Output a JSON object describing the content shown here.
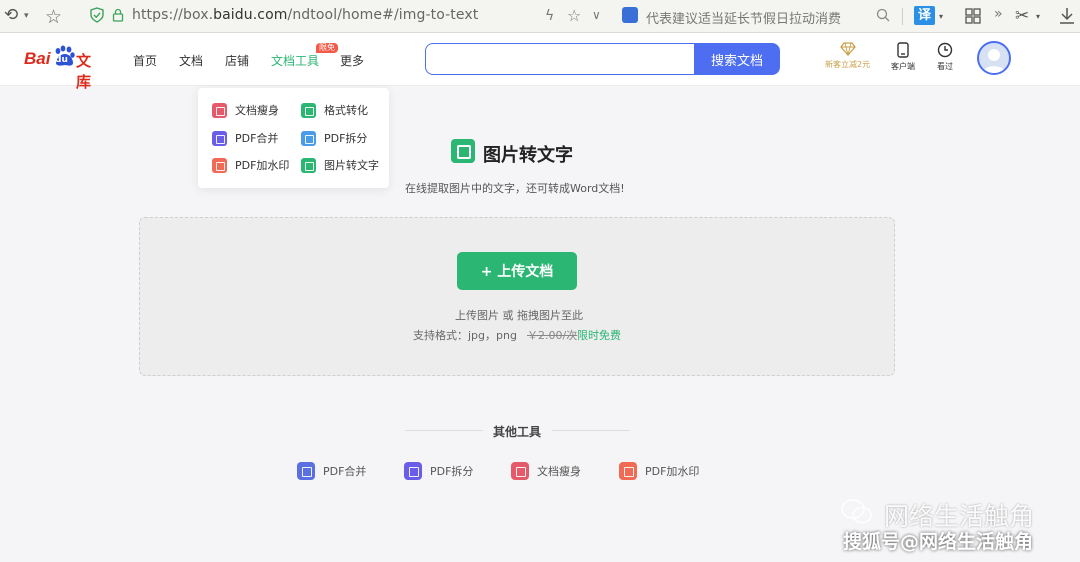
{
  "browser": {
    "url_prefix": "https://box.",
    "url_domain": "baidu.com",
    "url_path": "/ndtool/home#/img-to-text",
    "news_text": "代表建议适当延长节假日拉动消费",
    "translate_label": "译"
  },
  "header": {
    "logo_bai": "Bai",
    "logo_du": "du",
    "logo_wenku": "文库",
    "nav": [
      "首页",
      "文档",
      "店铺",
      "文档工具",
      "更多"
    ],
    "nav_badge": "限免",
    "search_placeholder": "",
    "search_button": "搜索文档",
    "vip_label": "新客立减2元",
    "client_label": "客户端",
    "history_label": "看过"
  },
  "dropdown": {
    "items": [
      "文档瘦身",
      "格式转化",
      "PDF合并",
      "PDF拆分",
      "PDF加水印",
      "图片转文字"
    ]
  },
  "main": {
    "title": "图片转文字",
    "subtitle": "在线提取图片中的文字，还可转成Word文档!",
    "upload_button": "+ 上传文档",
    "upload_hint": "上传图片 或 拖拽图片至此",
    "formats": "支持格式：jpg，png",
    "price_old": "￥2.00/次",
    "price_free": "限时免费"
  },
  "other_tools": {
    "title": "其他工具",
    "items": [
      "PDF合并",
      "PDF拆分",
      "文档瘦身",
      "PDF加水印"
    ]
  },
  "watermark": {
    "line1": "网络生活触角",
    "line2": "搜狐号@网络生活触角"
  },
  "colors": {
    "brand_green": "#2bb673",
    "brand_blue": "#4e6ef2",
    "baidu_red": "#de2a1c",
    "icon_red": "#e55a6a",
    "icon_green": "#2bb673",
    "icon_purple": "#6a5ee8",
    "icon_blue": "#4a9be8",
    "icon_orange": "#f06a55"
  }
}
